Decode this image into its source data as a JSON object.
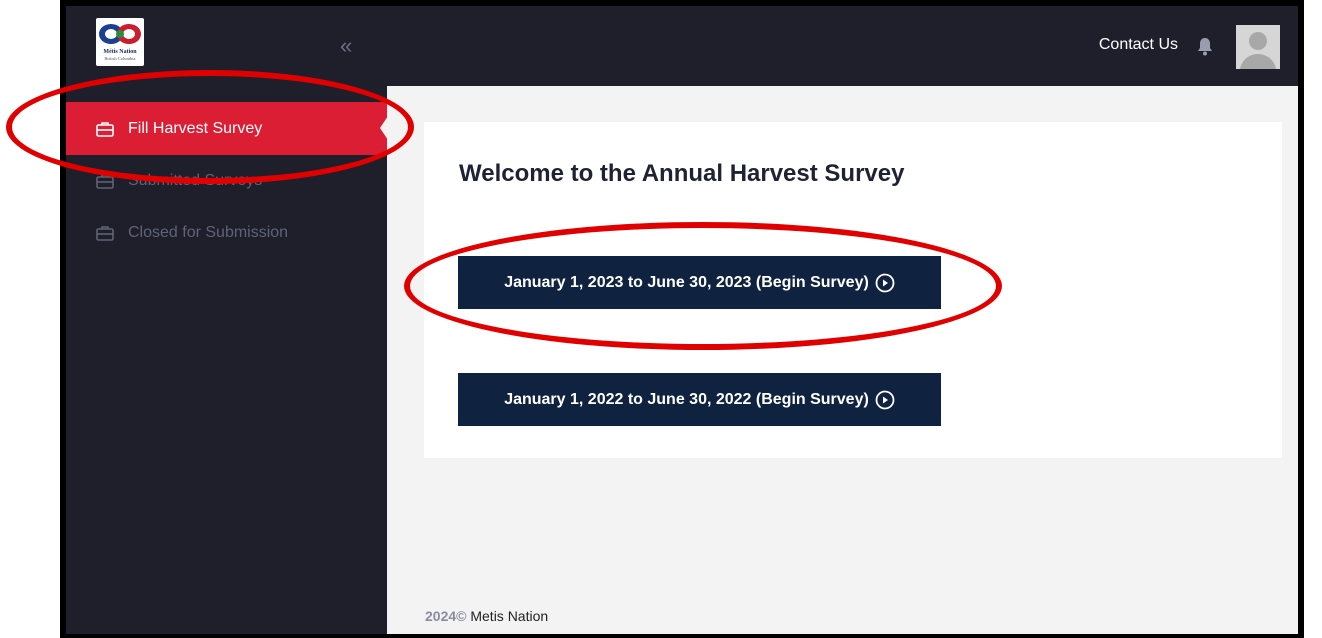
{
  "brand": {
    "logo_name": "Métis Nation",
    "logo_sub": "British Columbia"
  },
  "sidebar": {
    "collapse_glyph": "«",
    "items": [
      {
        "label": "Fill Harvest Survey",
        "icon": "briefcase-icon",
        "active": true
      },
      {
        "label": "Submitted Surveys",
        "icon": "briefcase-icon",
        "active": false
      },
      {
        "label": "Closed for Submission",
        "icon": "briefcase-icon",
        "active": false
      }
    ]
  },
  "header": {
    "contact_label": "Contact Us",
    "bell_icon": "bell-icon",
    "avatar_icon": "user-avatar-icon"
  },
  "main": {
    "title": "Welcome to the Annual Harvest Survey",
    "surveys": [
      {
        "label": "January 1, 2023 to June 30, 2023 (Begin Survey)"
      },
      {
        "label": "January 1, 2022 to June 30, 2022 (Begin Survey)"
      }
    ]
  },
  "footer": {
    "year": "2024©",
    "org": "Metis Nation"
  },
  "colors": {
    "sidebar_bg": "#1e1f2b",
    "active_red": "#dc1e35",
    "button_navy": "#0f2240",
    "annotation_red": "#e10000"
  }
}
